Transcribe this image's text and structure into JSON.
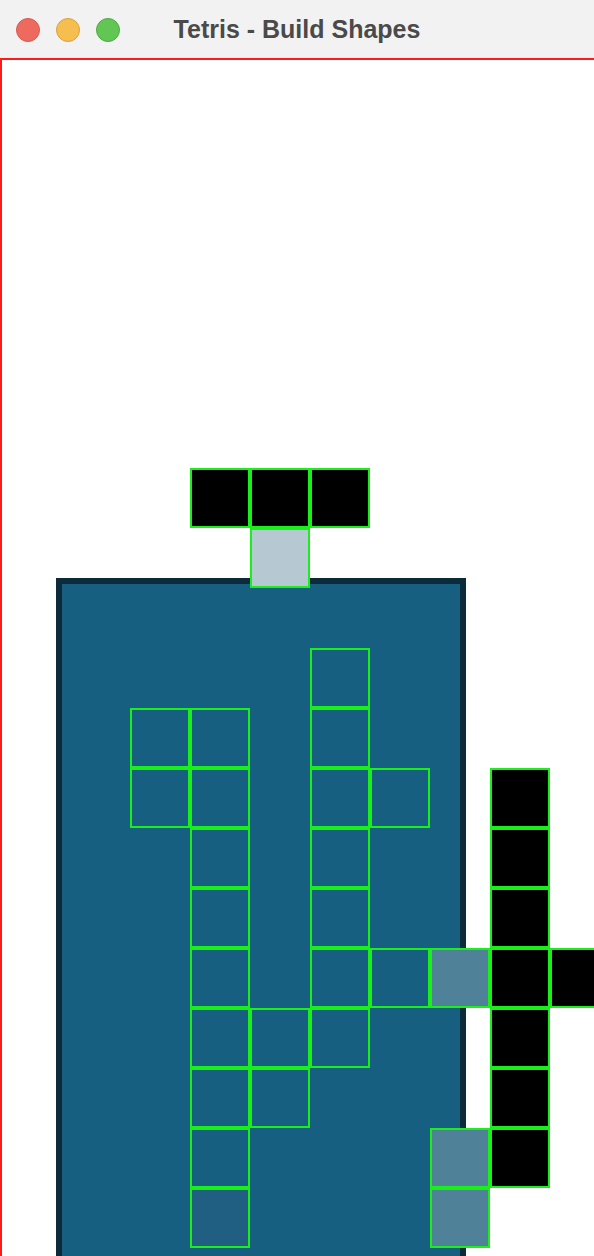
{
  "window": {
    "title": "Tetris - Build Shapes"
  },
  "cells": [
    {
      "col": 3,
      "row": 7,
      "kind": "block"
    },
    {
      "col": 4,
      "row": 7,
      "kind": "block"
    },
    {
      "col": 5,
      "row": 7,
      "kind": "block"
    },
    {
      "col": 4,
      "row": 8,
      "kind": "ghost"
    },
    {
      "col": 5,
      "row": 10,
      "kind": "outline"
    },
    {
      "col": 2,
      "row": 11,
      "kind": "outline"
    },
    {
      "col": 3,
      "row": 11,
      "kind": "outline"
    },
    {
      "col": 5,
      "row": 11,
      "kind": "outline"
    },
    {
      "col": 2,
      "row": 12,
      "kind": "outline"
    },
    {
      "col": 3,
      "row": 12,
      "kind": "outline"
    },
    {
      "col": 5,
      "row": 12,
      "kind": "outline"
    },
    {
      "col": 6,
      "row": 12,
      "kind": "outline"
    },
    {
      "col": 3,
      "row": 13,
      "kind": "outline"
    },
    {
      "col": 5,
      "row": 13,
      "kind": "outline"
    },
    {
      "col": 3,
      "row": 14,
      "kind": "outline"
    },
    {
      "col": 5,
      "row": 14,
      "kind": "outline"
    },
    {
      "col": 3,
      "row": 15,
      "kind": "outline"
    },
    {
      "col": 5,
      "row": 15,
      "kind": "outline"
    },
    {
      "col": 6,
      "row": 15,
      "kind": "outline"
    },
    {
      "col": 7,
      "row": 15,
      "kind": "tint"
    },
    {
      "col": 3,
      "row": 16,
      "kind": "outline"
    },
    {
      "col": 4,
      "row": 16,
      "kind": "outline"
    },
    {
      "col": 5,
      "row": 16,
      "kind": "outline"
    },
    {
      "col": 3,
      "row": 17,
      "kind": "outline"
    },
    {
      "col": 4,
      "row": 17,
      "kind": "outline"
    },
    {
      "col": 3,
      "row": 18,
      "kind": "outline"
    },
    {
      "col": 3,
      "row": 19,
      "kind": "dark"
    },
    {
      "col": 7,
      "row": 18,
      "kind": "tint"
    },
    {
      "col": 7,
      "row": 19,
      "kind": "tint"
    },
    {
      "col": 8,
      "row": 12,
      "kind": "block"
    },
    {
      "col": 8,
      "row": 13,
      "kind": "block"
    },
    {
      "col": 8,
      "row": 14,
      "kind": "block"
    },
    {
      "col": 8,
      "row": 15,
      "kind": "block"
    },
    {
      "col": 9,
      "row": 15,
      "kind": "block"
    },
    {
      "col": 8,
      "row": 16,
      "kind": "block"
    },
    {
      "col": 8,
      "row": 17,
      "kind": "block"
    },
    {
      "col": 8,
      "row": 18,
      "kind": "block"
    }
  ]
}
